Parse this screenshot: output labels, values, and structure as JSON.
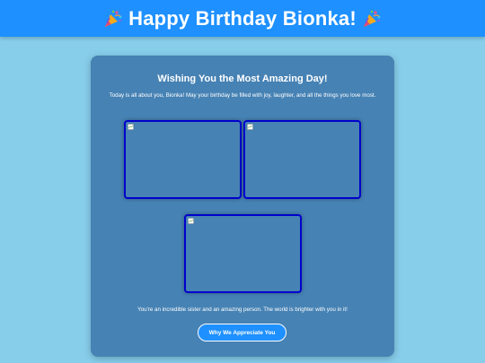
{
  "header": {
    "title": "Happy Birthday Bionka!",
    "left_icon": "party-popper-icon",
    "right_icon": "party-popper-icon",
    "background": "#1e90ff"
  },
  "card": {
    "title": "Wishing You the Most Amazing Day!",
    "intro": "Today is all about you, Bionka! May your birthday be filled with joy, laughter, and all the things you love most.",
    "photos": [
      {
        "state": "broken-image-icon"
      },
      {
        "state": "broken-image-icon"
      },
      {
        "state": "broken-image-icon"
      }
    ],
    "footer": "You're an incredible sister and an amazing person. The world is brighter with you in it!",
    "button_label": "Why We Appreciate You",
    "background": "#4682b4",
    "photo_border": "#0000cd"
  },
  "page": {
    "background": "#87ceeb"
  }
}
